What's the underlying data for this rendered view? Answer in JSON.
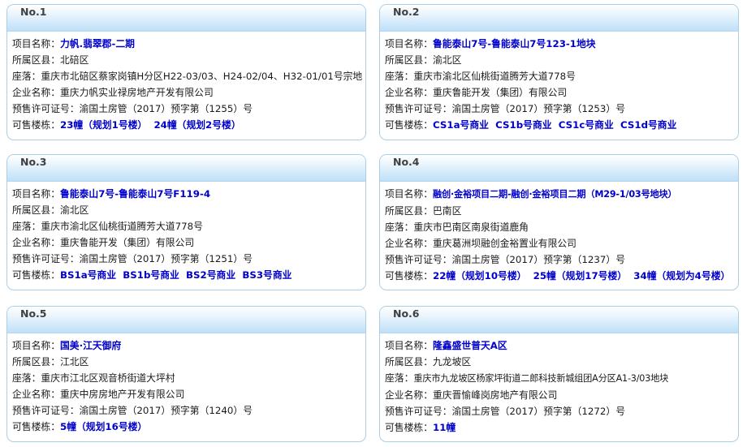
{
  "labels": {
    "project": "项目名称：",
    "district": "所属区县：",
    "location": "座落：",
    "company": "企业名称：",
    "permit": "预售许可证号：",
    "buildings": "可售楼栋："
  },
  "cards": [
    {
      "no": "No.1",
      "project": "力帆.翡翠郡-二期",
      "district": "北碚区",
      "location": "重庆市北碚区蔡家岗镇H分区H22-03/03、H24-02/04、H32-01/01号宗地",
      "company": "重庆力帆实业禄房地产开发有限公司",
      "permit": "渝国土房管（2017）预字第（1255）号",
      "buildings": [
        "23幢（规划1号楼）",
        "24幢（规划2号楼）"
      ]
    },
    {
      "no": "No.2",
      "project": "鲁能泰山7号-鲁能泰山7号123-1地块",
      "district": "渝北区",
      "location": "重庆市渝北区仙桃街道腾芳大道778号",
      "company": "重庆鲁能开发（集团）有限公司",
      "permit": "渝国土房管（2017）预字第（1253）号",
      "buildings": [
        "CS1a号商业",
        "CS1b号商业",
        "CS1c号商业",
        "CS1d号商业"
      ]
    },
    {
      "no": "No.3",
      "project": "鲁能泰山7号-鲁能泰山7号F119-4",
      "district": "渝北区",
      "location": "重庆市渝北区仙桃街道腾芳大道778号",
      "company": "重庆鲁能开发（集团）有限公司",
      "permit": "渝国土房管（2017）预字第（1251）号",
      "buildings": [
        "BS1a号商业",
        "BS1b号商业",
        "BS2号商业",
        "BS3号商业"
      ]
    },
    {
      "no": "No.4",
      "project": "融创·金裕项目二期-融创·金裕项目二期（M29-1/03号地块）",
      "district": "巴南区",
      "location": "重庆市巴南区南泉街道鹿角",
      "company": "重庆葛洲坝融创金裕置业有限公司",
      "permit": "渝国土房管（2017）预字第（1237）号",
      "buildings": [
        "22幢（规划10号楼）",
        "25幢（规划17号楼）",
        "34幢（规划为4号楼）"
      ]
    },
    {
      "no": "No.5",
      "project": "国美·江天御府",
      "district": "江北区",
      "location": "重庆市江北区观音桥街道大坪村",
      "company": "重庆中房房地产开发有限公司",
      "permit": "渝国土房管（2017）预字第（1240）号",
      "buildings": [
        "5幢（规划16号楼）"
      ]
    },
    {
      "no": "No.6",
      "project": "隆鑫盛世普天A区",
      "district": "九龙坡区",
      "location": "重庆市九龙坡区杨家坪街道二郎科技新城组团A分区A1-3/03地块",
      "company": "重庆晋愉峰岗房地产有限公司",
      "permit": "渝国土房管（2017）预字第（1272）号",
      "buildings": [
        "11幢"
      ]
    }
  ]
}
